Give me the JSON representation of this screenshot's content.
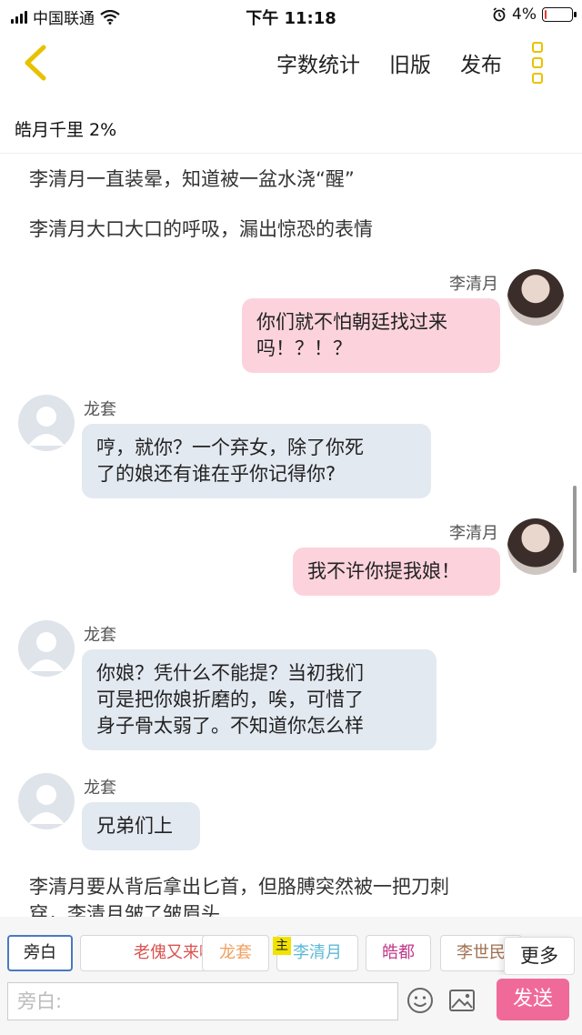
{
  "status": {
    "carrier": "中国联通",
    "time": "下午 11:18",
    "battery": "4%",
    "battery_level": 0.04
  },
  "nav": {
    "word_count": "字数统计",
    "old_version": "旧版",
    "publish": "发布"
  },
  "story": {
    "title_progress": "皓月千里 2%"
  },
  "messages": {
    "n1": "李清月一直装晕，知道被一盆水浇“醒”",
    "n2": "李清月大口大口的呼吸，漏出惊恐的表情",
    "m1_name": "李清月",
    "m1_l1": "你们就不怕朝廷找过来",
    "m1_l2": "吗！？！？",
    "m2_name": "龙套",
    "m2_l1": "哼，就你？一个弃女，除了你死",
    "m2_l2": "了的娘还有谁在乎你记得你?",
    "m3_name": "李清月",
    "m3_l1": "我不许你提我娘！",
    "m4_name": "龙套",
    "m4_l1": "你娘？凭什么不能提？当初我们",
    "m4_l2": "可是把你娘折磨的，唉，可惜了",
    "m4_l3": "身子骨太弱了。不知道你怎么样",
    "m5_name": "龙套",
    "m5_l1": "兄弟们上",
    "n3_l1": "李清月要从背后拿出匕首，但胳膊突然被一把刀刺",
    "n3_l2": "穿，李清月皱了皱眉头"
  },
  "roles": {
    "items": [
      "旁白",
      "老傀又来啦",
      "龙套",
      "李清月",
      "皓都",
      "李世民"
    ],
    "colors": [
      "#222222",
      "#d9534f",
      "#f0a060",
      "#5bb8d6",
      "#c0398a",
      "#a07050"
    ],
    "main_badge": "主",
    "more": "更多"
  },
  "input": {
    "placeholder": "旁白:",
    "send": "发送"
  }
}
